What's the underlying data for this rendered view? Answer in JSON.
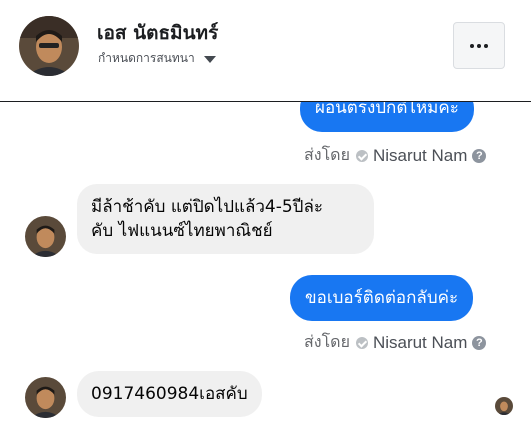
{
  "header": {
    "contact_name": "เอส นัตธมินทร์",
    "customize_label": "กำหนดการสนทนา"
  },
  "messages": [
    {
      "direction": "out",
      "text": "ผ่อนตรงปกติไหมคะ",
      "sent_via": "ส่งโดย",
      "agent": "Nisarut Nam"
    },
    {
      "direction": "in",
      "lines": [
        "มีล้าช้าคับ แต่ปิดไปแล้ว4-5ปีล่ะ",
        "คับ ไฟแนนซ์ไทยพาณิชย์"
      ]
    },
    {
      "direction": "out",
      "text": "ขอเบอร์ติดต่อกลับค่ะ",
      "sent_via": "ส่งโดย",
      "agent": "Nisarut Nam"
    },
    {
      "direction": "in",
      "text": "0917460984เอสคับ"
    }
  ],
  "icons": {
    "help": "?",
    "seen_check": "check-circle-icon",
    "more": "more-horizontal-icon",
    "caret": "caret-down-icon"
  },
  "colors": {
    "outgoing_bubble": "#1877f2",
    "incoming_bubble": "#f0f0f0",
    "meta_text": "#65676b"
  }
}
